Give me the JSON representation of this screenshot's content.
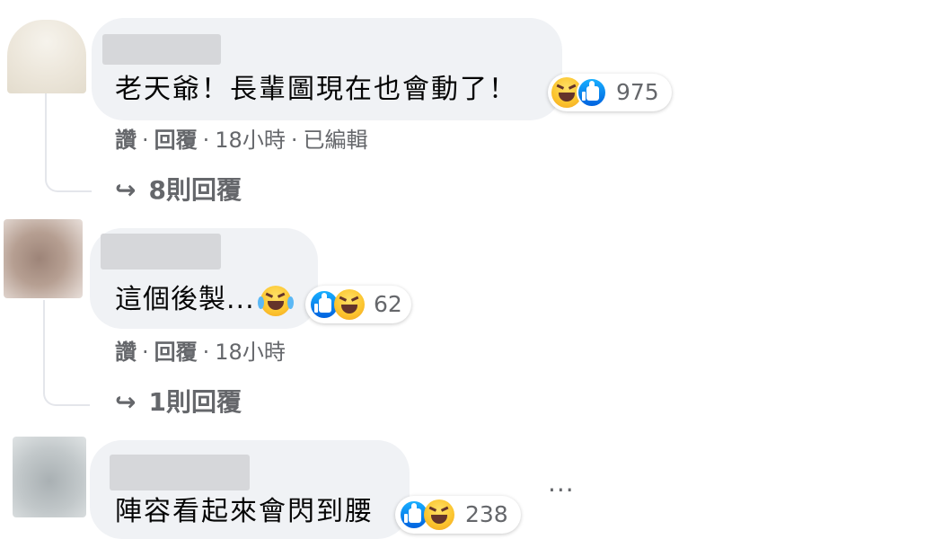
{
  "comments": [
    {
      "text": "老天爺！長輩圖現在也會動了！",
      "reactions": {
        "icons": [
          "haha-icon",
          "like-icon"
        ],
        "count": "975"
      },
      "actions": {
        "like": "讚",
        "reply": "回覆",
        "time": "18小時",
        "edited": "已編輯"
      },
      "replies_label": "8則回覆"
    },
    {
      "text": "這個後製...",
      "inline_emoji": "tears-of-joy-icon",
      "reactions": {
        "icons": [
          "like-icon",
          "haha-icon"
        ],
        "count": "62"
      },
      "actions": {
        "like": "讚",
        "reply": "回覆",
        "time": "18小時"
      },
      "replies_label": "1則回覆"
    },
    {
      "text": "陣容看起來會閃到腰",
      "reactions": {
        "icons": [
          "like-icon",
          "haha-icon"
        ],
        "count": "238"
      }
    }
  ],
  "ui": {
    "separator": "·",
    "reply_arrow": "↪",
    "more_glyph": "···"
  },
  "colors": {
    "bubble": "#f0f2f5",
    "secondary_text": "#65676b",
    "like_blue": "#0062df",
    "haha_yellow": "#fcc630"
  }
}
